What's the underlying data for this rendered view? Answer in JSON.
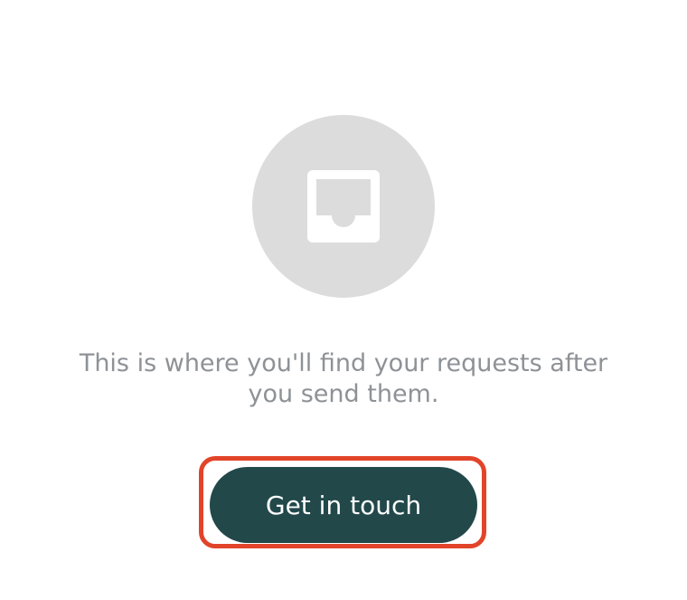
{
  "empty_state": {
    "icon": "inbox-icon",
    "message": "This is where you'll find your requests after you send them.",
    "cta_label": "Get in touch"
  },
  "colors": {
    "icon_circle": "#dcdcdc",
    "message_text": "#8e9296",
    "button_bg": "#22484a",
    "button_text": "#ffffff",
    "highlight_outline": "#e2442a"
  }
}
